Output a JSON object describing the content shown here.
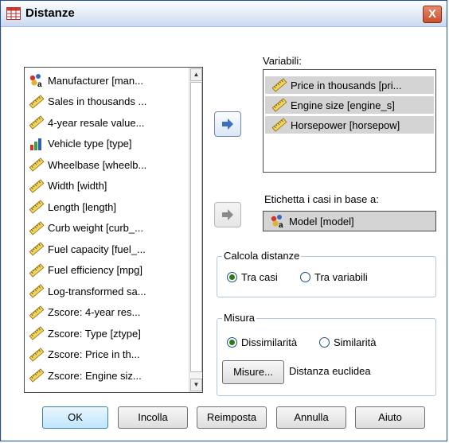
{
  "window": {
    "title": "Distanze",
    "close_glyph": "X"
  },
  "source_list": {
    "items": [
      {
        "icon": "nominal-icon",
        "label": "Manufacturer [man..."
      },
      {
        "icon": "scale-ruler-icon",
        "label": "Sales in thousands ..."
      },
      {
        "icon": "scale-ruler-icon",
        "label": "4-year resale value..."
      },
      {
        "icon": "ordinal-bar-icon",
        "label": "Vehicle type [type]"
      },
      {
        "icon": "scale-ruler-icon",
        "label": "Wheelbase [wheelb..."
      },
      {
        "icon": "scale-ruler-icon",
        "label": "Width [width]"
      },
      {
        "icon": "scale-ruler-icon",
        "label": "Length [length]"
      },
      {
        "icon": "scale-ruler-icon",
        "label": "Curb weight [curb_..."
      },
      {
        "icon": "scale-ruler-icon",
        "label": "Fuel capacity [fuel_..."
      },
      {
        "icon": "scale-ruler-icon",
        "label": "Fuel efficiency [mpg]"
      },
      {
        "icon": "scale-ruler-icon",
        "label": "Log-transformed sa..."
      },
      {
        "icon": "scale-ruler-icon",
        "label": "Zscore:  4-year res..."
      },
      {
        "icon": "scale-ruler-icon",
        "label": "Zscore:  Type [ztype]"
      },
      {
        "icon": "scale-ruler-icon",
        "label": "Zscore:  Price in th..."
      },
      {
        "icon": "scale-ruler-icon",
        "label": "Zscore:  Engine siz..."
      }
    ]
  },
  "variables": {
    "label": "Variabili:",
    "items": [
      {
        "icon": "scale-ruler-icon",
        "label": "Price in thousands [pri..."
      },
      {
        "icon": "scale-ruler-icon",
        "label": "Engine size [engine_s]"
      },
      {
        "icon": "scale-ruler-icon",
        "label": "Horsepower [horsepow]"
      }
    ]
  },
  "case_label": {
    "label": "Etichetta i casi in base a:",
    "value": "Model [model]"
  },
  "compute": {
    "title": "Calcola distanze",
    "options": [
      "Tra casi",
      "Tra variabili"
    ],
    "selected": 0
  },
  "measure": {
    "title": "Misura",
    "options": [
      "Dissimilarità",
      "Similarità"
    ],
    "selected": 0,
    "button_label": "Misure...",
    "current": "Distanza euclidea"
  },
  "buttons": {
    "ok": "OK",
    "paste": "Incolla",
    "reset": "Reimposta",
    "cancel": "Annulla",
    "help": "Aiuto"
  },
  "colors": {
    "arrow_active": "#3b6fc2",
    "arrow_disabled": "#8a8a8a",
    "selection_gray": "#d4d4d4",
    "radio_green": "#2a7a1a"
  }
}
